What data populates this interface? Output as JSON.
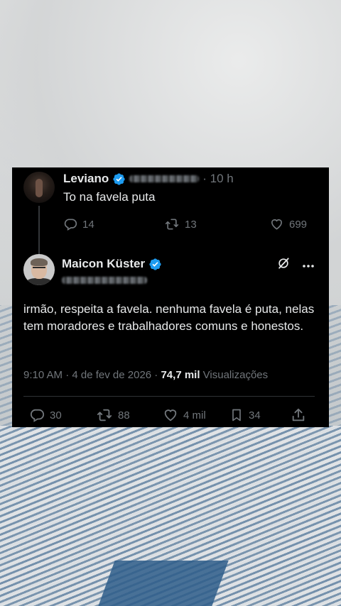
{
  "parent_tweet": {
    "name": "Leviano",
    "time": "· 10 h",
    "text": "To na favela puta",
    "replies": "14",
    "retweets": "13",
    "likes": "699"
  },
  "main_tweet": {
    "name": "Maicon Küster",
    "text": "irmão, respeita a favela. nenhuma favela é puta, nelas tem moradores e trabalhadores comuns e honestos.",
    "timestamp": "9:10 AM · 4 de fev de 2026 · ",
    "views_count": "74,7 mil",
    "views_label": " Visualizações",
    "replies": "30",
    "retweets": "88",
    "likes": "4 mil",
    "bookmarks": "34"
  },
  "colors": {
    "background": "#000000",
    "text": "#e7e9ea",
    "muted": "#71767b",
    "verified": "#1d9bf0",
    "divider": "#2f3336"
  },
  "icons": [
    "verified-badge-icon",
    "reply-icon",
    "retweet-icon",
    "like-icon",
    "bookmark-icon",
    "share-icon",
    "grok-icon",
    "more-icon"
  ]
}
